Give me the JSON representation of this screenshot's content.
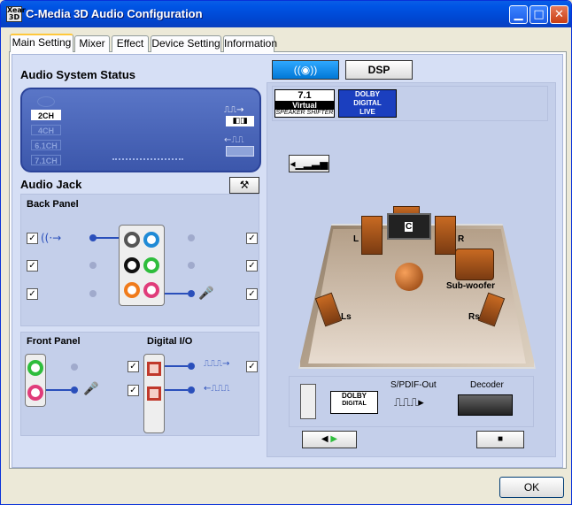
{
  "window": {
    "title": "C-Media 3D Audio Configuration",
    "icon_text": "Xear 3D",
    "min": "▁",
    "max": "□",
    "close": "✕"
  },
  "tabs": [
    {
      "label": "Main Setting"
    },
    {
      "label": "Mixer"
    },
    {
      "label": "Effect"
    },
    {
      "label": "Device Setting"
    },
    {
      "label": "Information"
    }
  ],
  "status": {
    "heading": "Audio System Status",
    "channels": [
      "",
      "2CH",
      "4CH",
      "6.1CH",
      "7.1CH"
    ],
    "selected": "2CH"
  },
  "jack": {
    "heading": "Audio Jack",
    "back_panel": "Back Panel",
    "front_panel": "Front Panel",
    "digital_io": "Digital I/O"
  },
  "right": {
    "virtual_label": "7.1",
    "virtual_sub": "Virtual",
    "shifter": "SPEAKER SHIFTER",
    "dolby": "DOLBY",
    "digital": "DIGITAL",
    "live": "LIVE"
  },
  "speakers": {
    "left": "L",
    "center": "C",
    "right": "R",
    "subwoofer": "Sub-woofer",
    "ls": "Ls",
    "rs": "Rs"
  },
  "bottom": {
    "spdif": "S/PDIF-Out",
    "decoder": "Decoder"
  },
  "dsp_label": "DSP",
  "ok": "OK",
  "colors": {
    "title_bar": "#0055e5",
    "panel": "#d6dff5",
    "accent": "#2a4fbb"
  }
}
